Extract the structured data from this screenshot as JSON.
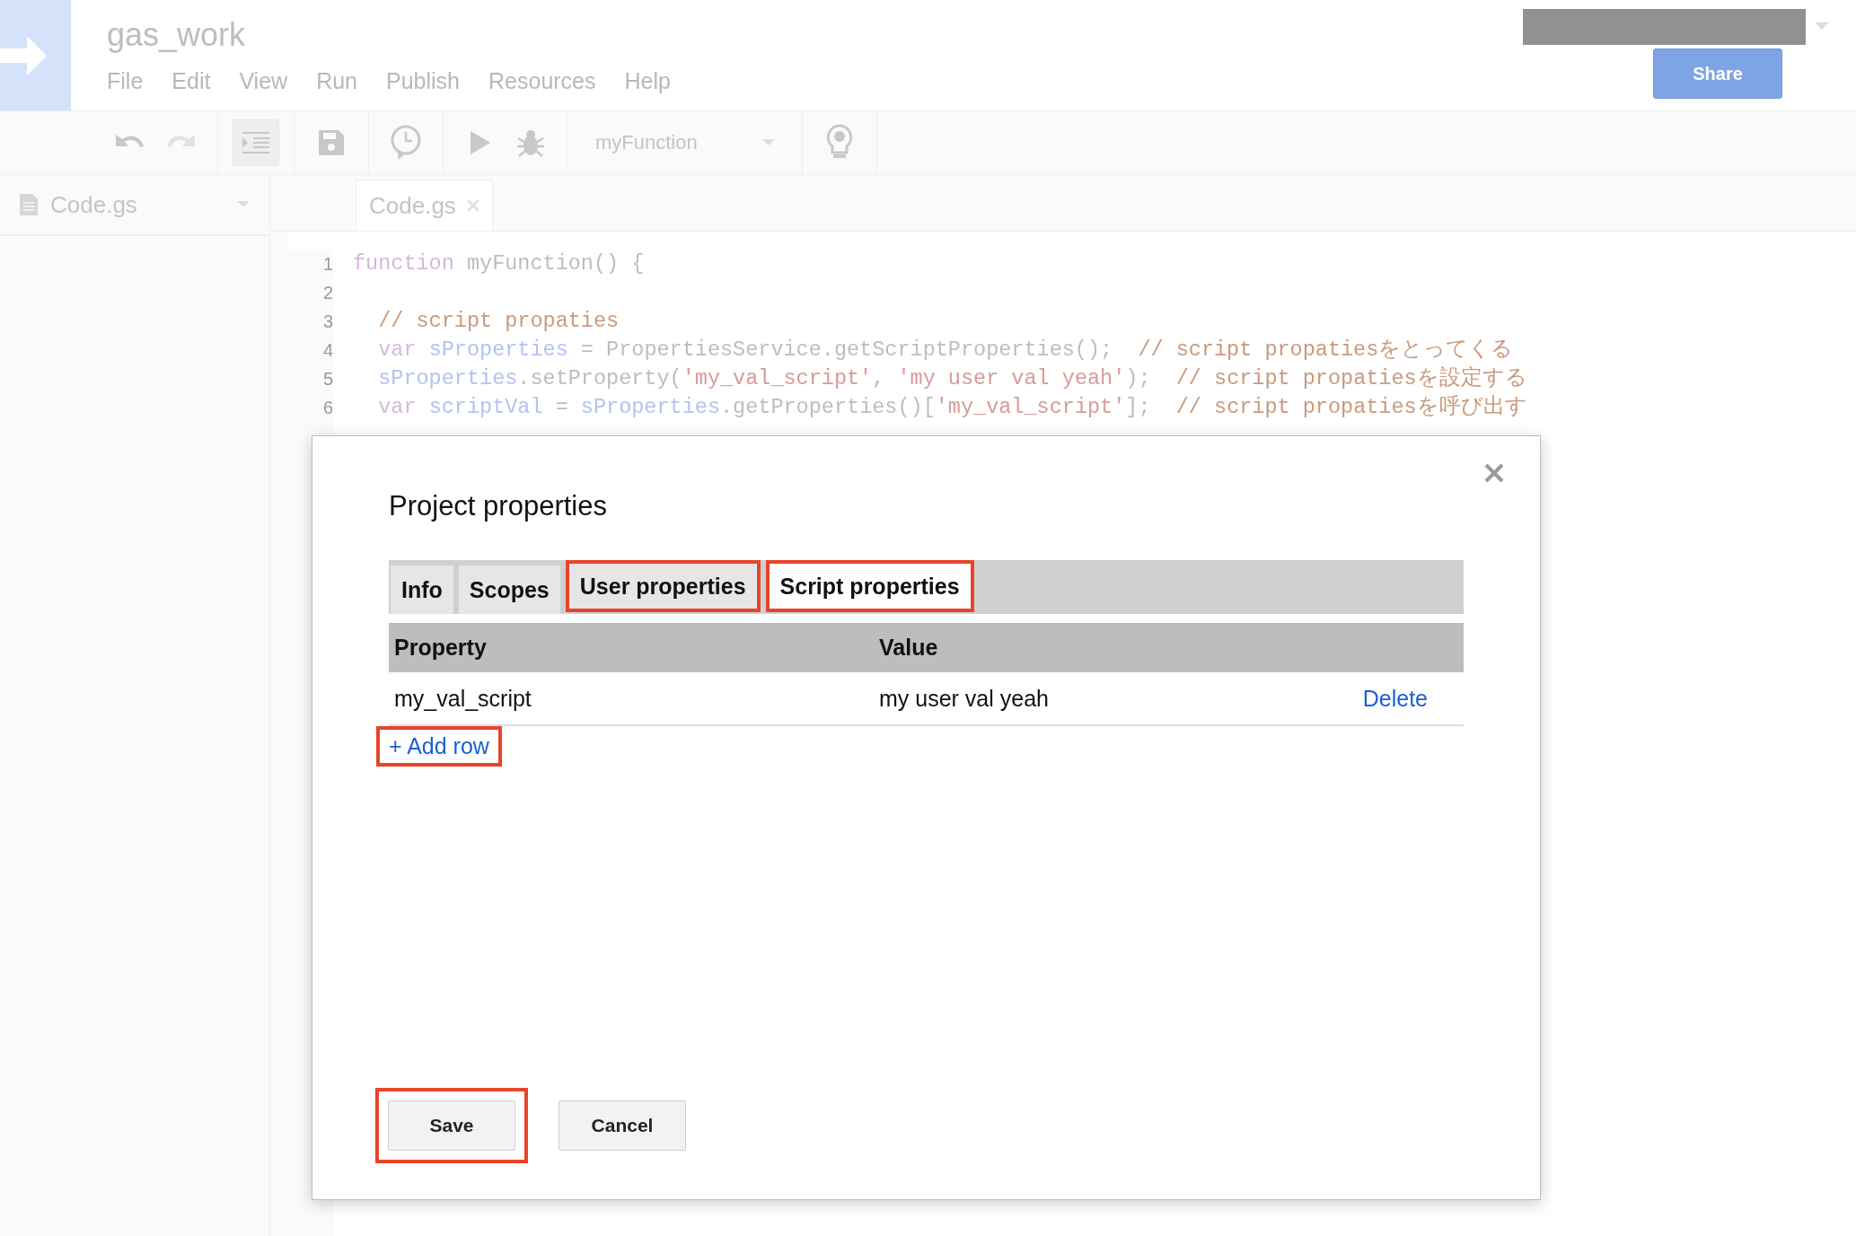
{
  "header": {
    "project_title": "gas_work",
    "menu": [
      "File",
      "Edit",
      "View",
      "Run",
      "Publish",
      "Resources",
      "Help"
    ],
    "share_button": "Share"
  },
  "toolbar": {
    "function_select": "myFunction"
  },
  "sidebar": {
    "files": [
      {
        "name": "Code.gs"
      }
    ]
  },
  "editor": {
    "tabs": [
      {
        "label": "Code.gs",
        "selected": true
      }
    ],
    "lines": [
      {
        "number": "1",
        "tokens": [
          {
            "kind": "keyword",
            "text": "function "
          },
          {
            "kind": "plain",
            "text": "myFunction() {"
          }
        ]
      },
      {
        "number": "2"
      },
      {
        "number": "3",
        "tokens": [
          {
            "kind": "comment",
            "text": "  // script propaties"
          }
        ]
      },
      {
        "number": "4",
        "tokens": [
          {
            "kind": "keyword",
            "text": "  var "
          },
          {
            "kind": "variable",
            "text": "sProperties"
          },
          {
            "kind": "plain",
            "text": " = PropertiesService.getScriptProperties();  "
          },
          {
            "kind": "comment",
            "text": "// script propatiesをとってくる"
          }
        ]
      },
      {
        "number": "5",
        "tokens": [
          {
            "kind": "variable",
            "text": "  sProperties"
          },
          {
            "kind": "plain",
            "text": ".setProperty("
          },
          {
            "kind": "string",
            "text": "'my_val_script'"
          },
          {
            "kind": "plain",
            "text": ", "
          },
          {
            "kind": "string",
            "text": "'my user val yeah'"
          },
          {
            "kind": "plain",
            "text": ");  "
          },
          {
            "kind": "comment",
            "text": "// script propatiesを設定する"
          }
        ]
      },
      {
        "number": "6",
        "tokens": [
          {
            "kind": "keyword",
            "text": "  var "
          },
          {
            "kind": "variable",
            "text": "scriptVal"
          },
          {
            "kind": "plain",
            "text": " = "
          },
          {
            "kind": "variable",
            "text": "sProperties"
          },
          {
            "kind": "plain",
            "text": ".getProperties()["
          },
          {
            "kind": "string",
            "text": "'my_val_script'"
          },
          {
            "kind": "plain",
            "text": "];  "
          },
          {
            "kind": "comment",
            "text": "// script propatiesを呼び出す"
          }
        ]
      }
    ]
  },
  "dialog": {
    "title": "Project properties",
    "tabs": [
      {
        "label": "Info",
        "selected": false,
        "highlighted": false
      },
      {
        "label": "Scopes",
        "selected": false,
        "highlighted": false
      },
      {
        "label": "User properties",
        "selected": false,
        "highlighted": true
      },
      {
        "label": "Script properties",
        "selected": true,
        "highlighted": true
      }
    ],
    "table": {
      "columns": [
        "Property",
        "Value"
      ],
      "rows": [
        {
          "property": "my_val_script",
          "value": "my user val yeah",
          "action": "Delete"
        }
      ]
    },
    "add_row": {
      "label": "+ Add row",
      "highlighted": true
    },
    "buttons": [
      {
        "label": "Save",
        "highlighted": true
      },
      {
        "label": "Cancel",
        "highlighted": false
      }
    ]
  }
}
